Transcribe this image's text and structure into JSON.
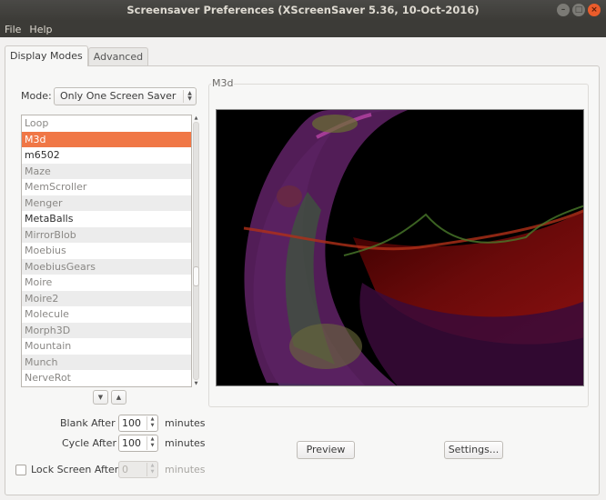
{
  "window": {
    "title": "Screensaver Preferences  (XScreenSaver 5.36, 10-Oct-2016)",
    "controls": [
      "minimize",
      "maximize",
      "close"
    ]
  },
  "menubar": {
    "items": [
      {
        "label": "File"
      },
      {
        "label": "Help"
      }
    ]
  },
  "tabs": [
    {
      "label": "Display Modes",
      "active": true
    },
    {
      "label": "Advanced",
      "active": false
    }
  ],
  "display_modes": {
    "mode_label": "Mode:",
    "mode_value": "Only One Screen Saver",
    "list": [
      {
        "name": "Loop",
        "enabled": false,
        "selected": false
      },
      {
        "name": "M3d",
        "enabled": false,
        "selected": true
      },
      {
        "name": "m6502",
        "enabled": true,
        "selected": false
      },
      {
        "name": "Maze",
        "enabled": false,
        "selected": false
      },
      {
        "name": "MemScroller",
        "enabled": false,
        "selected": false
      },
      {
        "name": "Menger",
        "enabled": false,
        "selected": false
      },
      {
        "name": "MetaBalls",
        "enabled": true,
        "selected": false
      },
      {
        "name": "MirrorBlob",
        "enabled": false,
        "selected": false
      },
      {
        "name": "Moebius",
        "enabled": false,
        "selected": false
      },
      {
        "name": "MoebiusGears",
        "enabled": false,
        "selected": false
      },
      {
        "name": "Moire",
        "enabled": false,
        "selected": false
      },
      {
        "name": "Moire2",
        "enabled": false,
        "selected": false
      },
      {
        "name": "Molecule",
        "enabled": false,
        "selected": false
      },
      {
        "name": "Morph3D",
        "enabled": false,
        "selected": false
      },
      {
        "name": "Mountain",
        "enabled": false,
        "selected": false
      },
      {
        "name": "Munch",
        "enabled": false,
        "selected": false
      },
      {
        "name": "NerveRot",
        "enabled": false,
        "selected": false
      }
    ],
    "move_down_icon": "▼",
    "move_up_icon": "▲",
    "blank_after": {
      "label": "Blank After",
      "value": "100",
      "unit": "minutes"
    },
    "cycle_after": {
      "label": "Cycle After",
      "value": "100",
      "unit": "minutes"
    },
    "lock_screen_after": {
      "label": "Lock Screen After",
      "value": "0",
      "unit": "minutes",
      "checked": false,
      "disabled": true
    }
  },
  "preview": {
    "title": "M3d",
    "preview_button": "Preview",
    "settings_button": "Settings..."
  },
  "colors": {
    "accent": "#f07746",
    "titlebar": "#3c3b37",
    "close_button": "#ea5c2b"
  }
}
